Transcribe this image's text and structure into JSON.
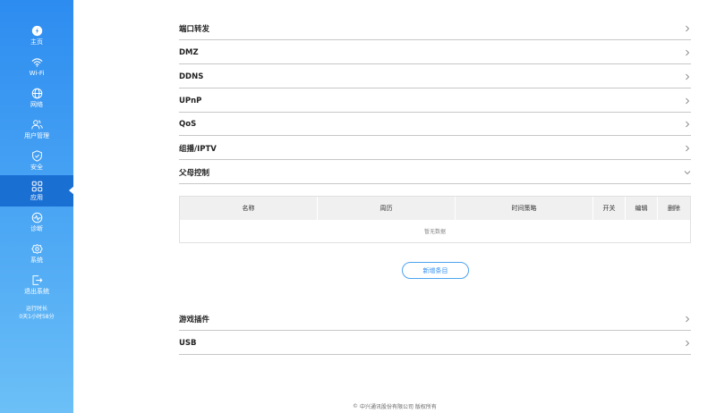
{
  "sidebar": {
    "items": [
      {
        "label": "主页",
        "icon": "home-icon"
      },
      {
        "label": "Wi-Fi",
        "icon": "wifi-icon"
      },
      {
        "label": "网络",
        "icon": "globe-icon"
      },
      {
        "label": "用户管理",
        "icon": "users-icon"
      },
      {
        "label": "安全",
        "icon": "shield-icon"
      },
      {
        "label": "应用",
        "icon": "apps-grid-icon"
      },
      {
        "label": "诊断",
        "icon": "diagnostic-icon"
      },
      {
        "label": "系统",
        "icon": "gear-icon"
      },
      {
        "label": "退出系统",
        "icon": "logout-icon"
      }
    ],
    "active": "应用",
    "runtime_label": "运行时长",
    "runtime_value": "0天1小时58分"
  },
  "sections_top": [
    {
      "title": "端口转发",
      "expanded": false
    },
    {
      "title": "DMZ",
      "expanded": false
    },
    {
      "title": "DDNS",
      "expanded": false
    },
    {
      "title": "UPnP",
      "expanded": false
    },
    {
      "title": "QoS",
      "expanded": false
    },
    {
      "title": "组播/IPTV",
      "expanded": false
    },
    {
      "title": "父母控制",
      "expanded": true
    }
  ],
  "parental_table": {
    "headers": [
      "名称",
      "周历",
      "时间策略",
      "开关",
      "编辑",
      "删除"
    ],
    "empty_text": "暂无数据"
  },
  "add_button": "新增条目",
  "sections_bottom": [
    {
      "title": "游戏插件",
      "expanded": false
    },
    {
      "title": "USB",
      "expanded": false
    }
  ],
  "footer": {
    "symbol": "©",
    "text": "中兴通讯股份有限公司 版权所有"
  },
  "colors": {
    "sidebar_top": "#2d8cf0",
    "sidebar_bottom": "#6cc0f7",
    "sidebar_active": "#1a6fd3",
    "accent": "#2d8cf0",
    "divider": "#c7c7c7",
    "table_header_bg": "#f0f0f0"
  }
}
